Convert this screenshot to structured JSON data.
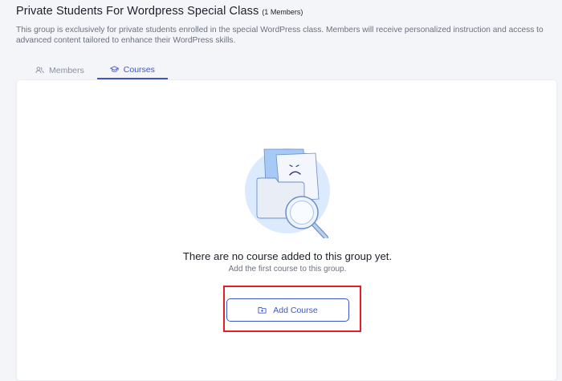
{
  "group": {
    "title": "Private Students For Wordpress Special Class",
    "member_count": "(1 Members)",
    "description": "This group is exclusively for private students enrolled in the special WordPress class. Members will receive personalized instruction and access to advanced content tailored to enhance their WordPress skills."
  },
  "tabs": [
    {
      "label": "Members",
      "icon": "members-icon",
      "active": false
    },
    {
      "label": "Courses",
      "icon": "graduation-cap-icon",
      "active": true
    }
  ],
  "empty_state": {
    "title": "There are no course added to this group yet.",
    "subtitle": "Add the first course to this group.",
    "illustration": "sad-folder-magnifier-icon"
  },
  "actions": {
    "add_course_label": "Add Course",
    "add_course_icon": "folder-plus-icon"
  },
  "colors": {
    "accent": "#3c57c7",
    "highlight": "#e41e26",
    "background": "#f4f5f8"
  }
}
